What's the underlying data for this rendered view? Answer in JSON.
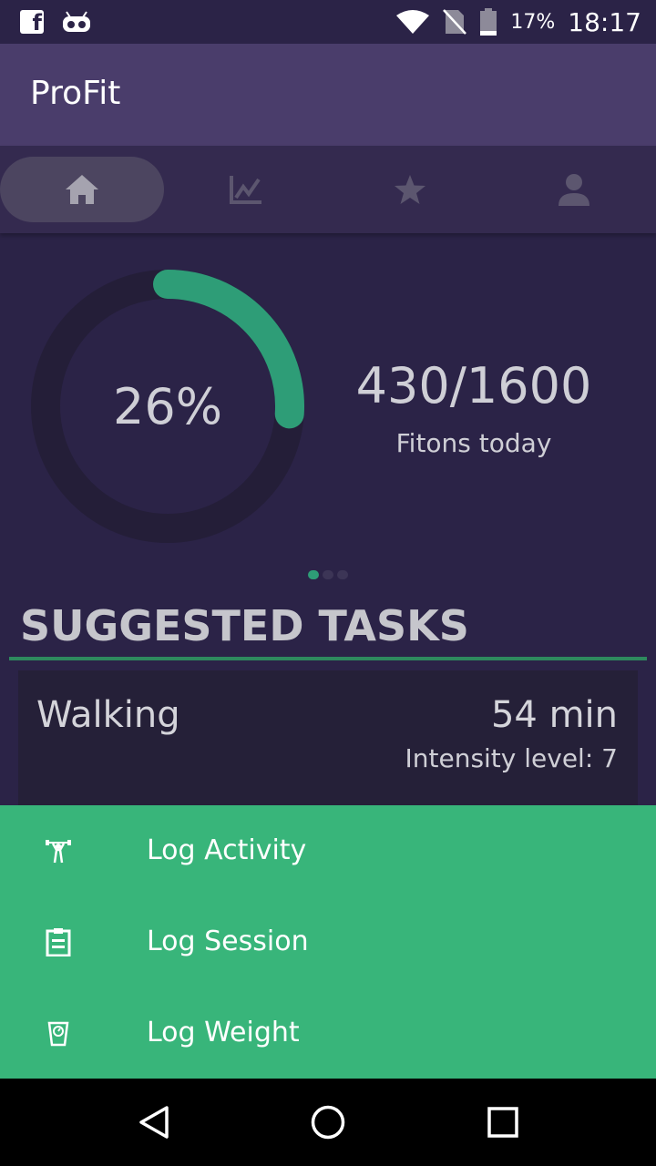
{
  "status_bar": {
    "battery_percent": "17%",
    "time": "18:17",
    "icons": [
      "facebook-icon",
      "android-bot-icon",
      "wifi-icon",
      "no-sim-icon",
      "battery-icon"
    ]
  },
  "app": {
    "title": "ProFit"
  },
  "tabs": [
    {
      "icon": "home-icon",
      "active": true
    },
    {
      "icon": "chart-icon",
      "active": false
    },
    {
      "icon": "star-icon",
      "active": false
    },
    {
      "icon": "person-icon",
      "active": false
    }
  ],
  "progress": {
    "percent_label": "26%",
    "fraction": 0.26,
    "fitons_value": "430/1600",
    "fitons_label": "Fitons today",
    "page_dots": 3,
    "active_dot": 0
  },
  "suggested": {
    "title": "SUGGESTED TASKS",
    "tasks": [
      {
        "name": "Walking",
        "duration": "54 min",
        "intensity": "Intensity level: 7"
      }
    ]
  },
  "actions": [
    {
      "label": "Log Activity",
      "icon": "weightlifter-icon"
    },
    {
      "label": "Log Session",
      "icon": "clipboard-icon"
    },
    {
      "label": "Log Weight",
      "icon": "scale-icon"
    }
  ],
  "colors": {
    "background": "#2b2347",
    "app_bar": "#4a3d6b",
    "accent_green": "#38b57a",
    "ring_progress": "#2e9d77",
    "ring_track": "#241e38"
  }
}
